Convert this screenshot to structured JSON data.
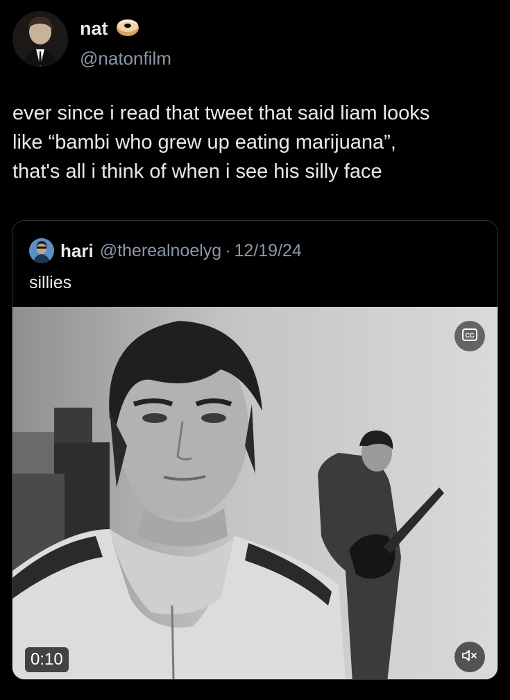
{
  "tweet": {
    "author": {
      "display_name": "nat",
      "handle": "@natonfilm",
      "name_emoji": "bagel-emoji"
    },
    "text_lines": [
      "ever since i read that tweet that said liam looks",
      "like “bambi who grew up eating marijuana”,",
      "that's all i think of when i see his silly face"
    ]
  },
  "quote": {
    "author": {
      "display_name": "hari",
      "handle": "@therealnoelyg",
      "separator": "·",
      "date": "12/19/24"
    },
    "text": "sillies",
    "video": {
      "duration": "0:10",
      "captions_icon": "cc-icon",
      "mute_icon": "muted-speaker-icon"
    }
  }
}
